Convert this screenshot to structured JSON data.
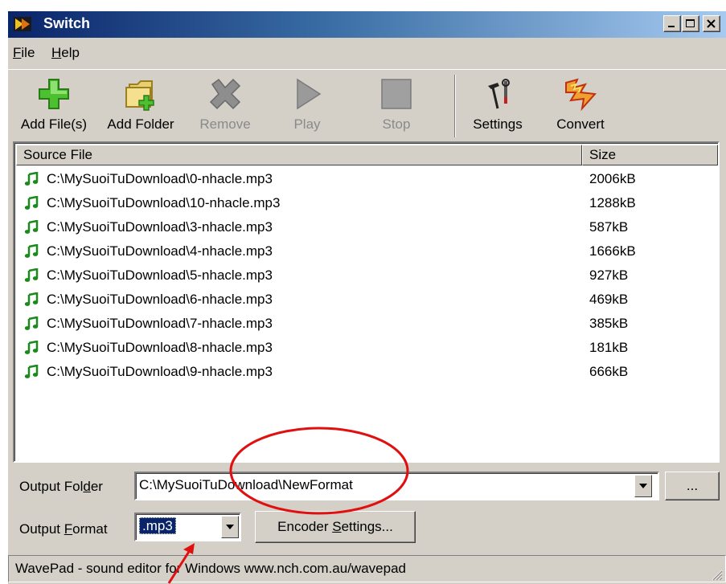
{
  "window": {
    "title": "Switch"
  },
  "menu": [
    {
      "label": "File",
      "mnemonic": "F",
      "rest": "ile"
    },
    {
      "label": "Help",
      "mnemonic": "H",
      "rest": "elp"
    }
  ],
  "toolbar": {
    "add_files": "Add File(s)",
    "add_folder": "Add Folder",
    "remove": "Remove",
    "play": "Play",
    "stop": "Stop",
    "settings": "Settings",
    "convert": "Convert"
  },
  "file_list": {
    "columns": [
      "Source File",
      "Size"
    ],
    "rows": [
      {
        "file": "C:\\MySuoiTuDownload\\0-nhacle.mp3",
        "size": "2006kB"
      },
      {
        "file": "C:\\MySuoiTuDownload\\10-nhacle.mp3",
        "size": "1288kB"
      },
      {
        "file": "C:\\MySuoiTuDownload\\3-nhacle.mp3",
        "size": "587kB"
      },
      {
        "file": "C:\\MySuoiTuDownload\\4-nhacle.mp3",
        "size": "1666kB"
      },
      {
        "file": "C:\\MySuoiTuDownload\\5-nhacle.mp3",
        "size": "927kB"
      },
      {
        "file": "C:\\MySuoiTuDownload\\6-nhacle.mp3",
        "size": "469kB"
      },
      {
        "file": "C:\\MySuoiTuDownload\\7-nhacle.mp3",
        "size": "385kB"
      },
      {
        "file": "C:\\MySuoiTuDownload\\8-nhacle.mp3",
        "size": "181kB"
      },
      {
        "file": "C:\\MySuoiTuDownload\\9-nhacle.mp3",
        "size": "666kB"
      }
    ]
  },
  "output": {
    "folder_label_pre": "Output Fol",
    "folder_label_mnemonic": "d",
    "folder_label_post": "er",
    "folder_value": "C:\\MySuoiTuDownload\\NewFormat",
    "browse_label": "...",
    "format_label_pre": "Output ",
    "format_label_mnemonic": "F",
    "format_label_post": "ormat",
    "format_value": ".mp3",
    "encoder_pre": "Encoder ",
    "encoder_mnemonic": "S",
    "encoder_post": "ettings..."
  },
  "status": {
    "text": "WavePad - sound editor for Windows www.nch.com.au/wavepad"
  },
  "colors": {
    "annotation": "#e01010",
    "selection": "#0a246a",
    "note_icon": "#1a8a1a"
  }
}
